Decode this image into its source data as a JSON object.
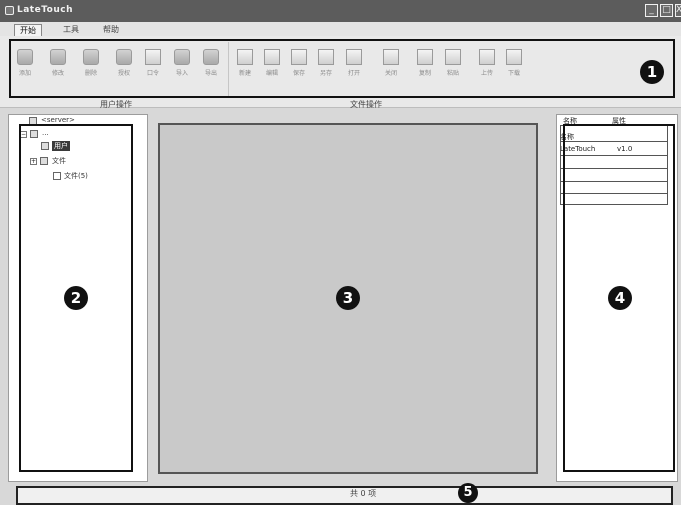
{
  "window": {
    "title": "LateTouch",
    "minimize_label": "_",
    "restore_label": "□",
    "close_label": "X"
  },
  "menu": {
    "tabs": [
      {
        "label": "开始",
        "active": true
      },
      {
        "label": "工具",
        "active": false
      },
      {
        "label": "帮助",
        "active": false
      }
    ]
  },
  "ribbon": {
    "groups": [
      {
        "label": "用户操作"
      },
      {
        "label": "文件操作"
      }
    ],
    "tools": [
      {
        "label": "添加",
        "icon": "user-icon"
      },
      {
        "label": "修改",
        "icon": "user-icon"
      },
      {
        "label": "删除",
        "icon": "user-icon"
      },
      {
        "label": "授权",
        "icon": "key-icon"
      },
      {
        "label": "口令",
        "icon": "monitor-icon"
      },
      {
        "label": "导入",
        "icon": "user-icon"
      },
      {
        "label": "导出",
        "icon": "user-icon"
      },
      {
        "label": "新建",
        "icon": "new-file-icon"
      },
      {
        "label": "编辑",
        "icon": "edit-icon"
      },
      {
        "label": "保存",
        "icon": "save-icon"
      },
      {
        "label": "另存",
        "icon": "save-as-icon"
      },
      {
        "label": "打开",
        "icon": "open-file-icon"
      },
      {
        "label": "关闭",
        "icon": "close-file-icon"
      },
      {
        "label": "复制",
        "icon": "copy-icon"
      },
      {
        "label": "粘贴",
        "icon": "paste-icon"
      },
      {
        "label": "上传",
        "icon": "upload-icon"
      },
      {
        "label": "下载",
        "icon": "download-icon"
      }
    ]
  },
  "tree": {
    "root_label": "<server>",
    "nodes": [
      {
        "label": "..."
      },
      {
        "label": "用户"
      },
      {
        "label": "文件"
      },
      {
        "label": "文件(5)"
      }
    ]
  },
  "properties": {
    "tabs": [
      {
        "label": "名称"
      },
      {
        "label": "属性"
      }
    ],
    "rows": [
      {
        "name": "名称",
        "value": ""
      },
      {
        "name": "LateTouch",
        "value": "v1.0"
      },
      {
        "name": "",
        "value": ""
      },
      {
        "name": "",
        "value": ""
      }
    ]
  },
  "status": {
    "text": "共 0 项"
  },
  "callouts": [
    "1",
    "2",
    "3",
    "4",
    "5"
  ]
}
